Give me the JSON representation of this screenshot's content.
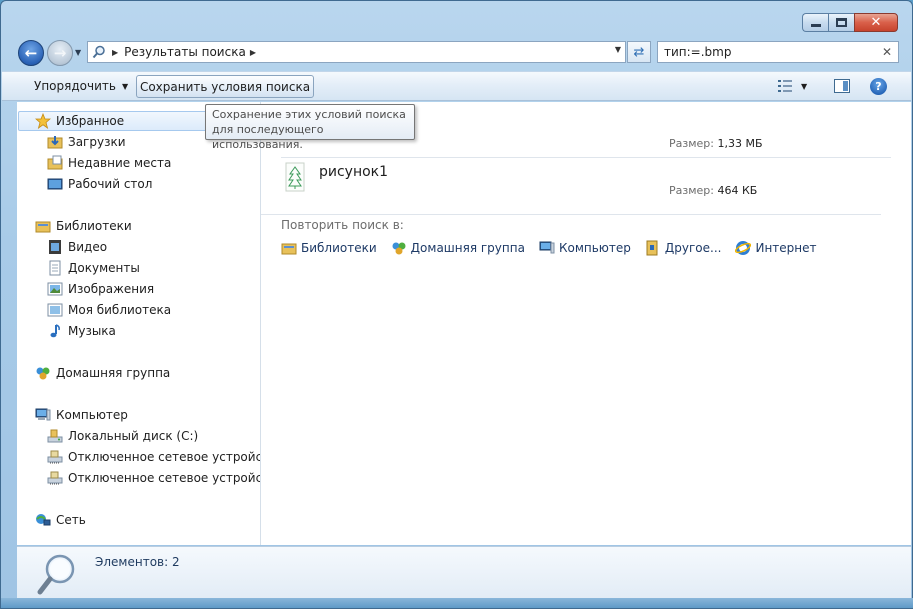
{
  "window": {
    "breadcrumb": [
      "Результаты поиска"
    ],
    "caption": {
      "minimize_icon": "minimize-icon",
      "maximize_icon": "maximize-icon",
      "close_glyph": "✕"
    }
  },
  "search": {
    "value": "тип:=.bmp",
    "clear_glyph": "✕"
  },
  "toolbar": {
    "organize_label": "Упорядочить",
    "save_search_label": "Сохранить условия поиска"
  },
  "tooltip": {
    "line1": "Сохранение этих условий поиска",
    "line2": "для последующего использования."
  },
  "sidebar": {
    "favorites": {
      "label": "Избранное",
      "items": [
        "Загрузки",
        "Недавние места",
        "Рабочий стол"
      ]
    },
    "libraries": {
      "label": "Библиотеки",
      "items": [
        "Видео",
        "Документы",
        "Изображения",
        "Моя библиотека",
        "Музыка"
      ]
    },
    "homegroup": {
      "label": "Домашняя группа"
    },
    "computer": {
      "label": "Компьютер",
      "items": [
        "Локальный диск (C:)",
        "Отключенное сетевое устройство (",
        "Отключенное сетевое устройство ("
      ]
    },
    "network": {
      "label": "Сеть"
    }
  },
  "results": [
    {
      "name": "",
      "size_label": "Размер:",
      "size_value": "1,33 МБ"
    },
    {
      "name": "рисунок1",
      "size_label": "Размер:",
      "size_value": "464 КБ"
    }
  ],
  "retry": {
    "label": "Повторить поиск в:",
    "links": [
      "Библиотеки",
      "Домашняя группа",
      "Компьютер",
      "Другое...",
      "Интернет"
    ]
  },
  "status": {
    "items_text": "Элементов: 2"
  }
}
